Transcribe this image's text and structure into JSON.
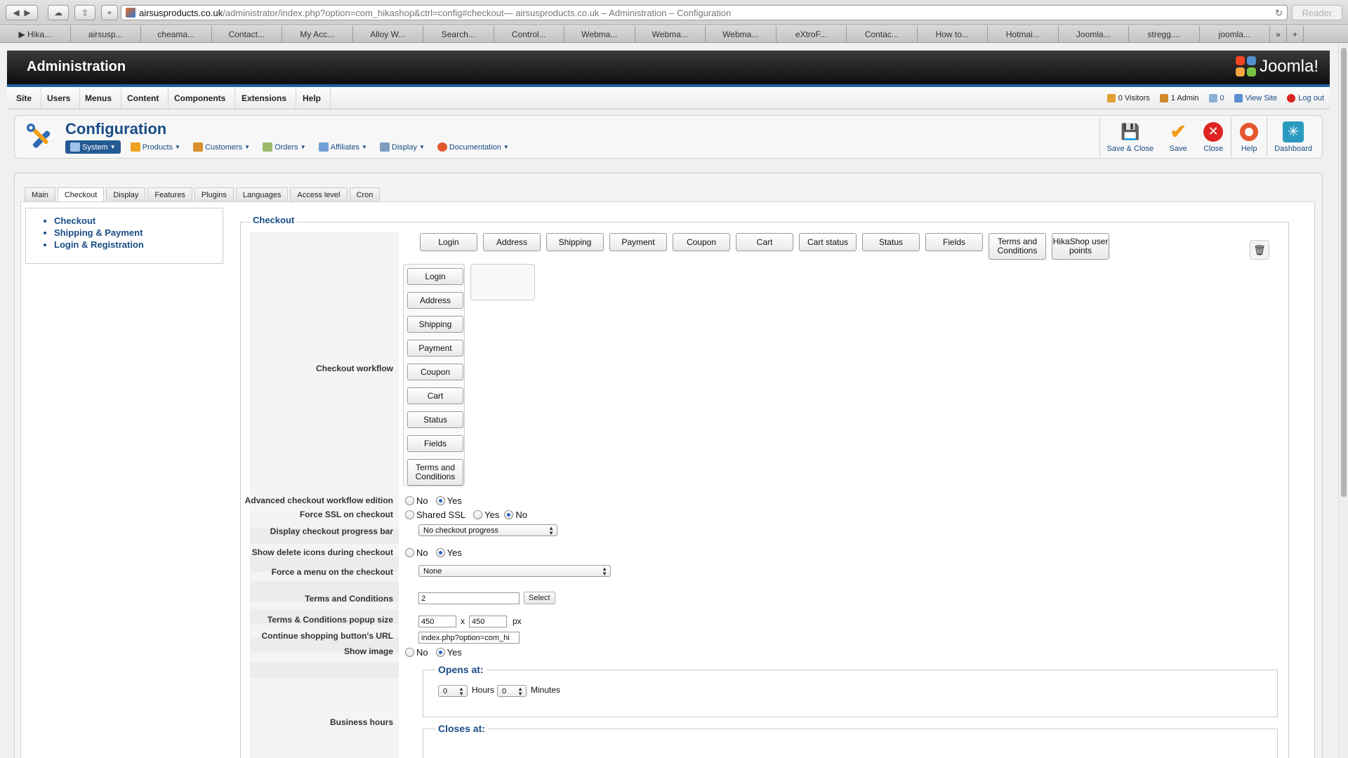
{
  "browser": {
    "url_host": "airsusproducts.co.uk",
    "url_path": "/administrator/index.php?option=com_hikashop&ctrl=config#checkout",
    "url_title": " — airsusproducts.co.uk – Administration – Configuration",
    "reader_label": "Reader",
    "bookmarks": [
      "▶ Hika...",
      "airsusp...",
      "cheama...",
      "Contact...",
      "My Acc...",
      "Alloy W...",
      "Search...",
      "Control...",
      "Webma...",
      "Webma...",
      "Webma...",
      "eXtroF...",
      "Contac...",
      "How to...",
      "Hotmai...",
      "Joomla...",
      "stregg....",
      "joomla..."
    ],
    "bookmarks_more": "»"
  },
  "admin": {
    "title": "Administration",
    "logo_text": "Joomla!"
  },
  "main_menu": [
    "Site",
    "Users",
    "Menus",
    "Content",
    "Components",
    "Extensions",
    "Help"
  ],
  "status": {
    "visitors": "0 Visitors",
    "admins": "1 Admin",
    "messages": "0",
    "view_site": "View Site",
    "logout": "Log out"
  },
  "config_header": {
    "title": "Configuration",
    "submenu": [
      "System",
      "Products",
      "Customers",
      "Orders",
      "Affiliates",
      "Display",
      "Documentation"
    ]
  },
  "toolbar": {
    "save_close": "Save & Close",
    "save": "Save",
    "close": "Close",
    "help": "Help",
    "dashboard": "Dashboard"
  },
  "tabs": [
    "Main",
    "Checkout",
    "Display",
    "Features",
    "Plugins",
    "Languages",
    "Access level",
    "Cron"
  ],
  "side_nav": [
    "Checkout",
    "Shipping & Payment",
    "Login & Registration"
  ],
  "checkout": {
    "legend": "Checkout",
    "available_steps": [
      "Login",
      "Address",
      "Shipping",
      "Payment",
      "Coupon",
      "Cart",
      "Cart status",
      "Status",
      "Fields",
      "Terms and Conditions",
      "HikaShop user points"
    ],
    "workflow_label": "Checkout workflow",
    "workflow_steps": [
      "Login",
      "Address",
      "Shipping",
      "Payment",
      "Coupon",
      "Cart",
      "Status",
      "Fields",
      "Terms and Conditions"
    ],
    "advanced_label": "Advanced checkout workflow edition",
    "no": "No",
    "yes": "Yes",
    "ssl_label": "Force SSL on checkout",
    "shared_ssl": "Shared SSL",
    "progress_label": "Display checkout progress bar",
    "progress_value": "No checkout progress",
    "delete_icons_label": "Show delete icons during checkout",
    "force_menu_label": "Force a menu on the checkout",
    "force_menu_value": "None",
    "terms_label": "Terms and Conditions",
    "terms_value": "2",
    "select_label": "Select",
    "popup_size_label": "Terms & Conditions popup size",
    "popup_w": "450",
    "popup_x": "x",
    "popup_h": "450",
    "popup_unit": "px",
    "continue_url_label": "Continue shopping button's URL",
    "continue_url_value": "index.php?option=com_hi",
    "show_image_label": "Show image",
    "business_hours_label": "Business hours",
    "opens_at": "Opens at:",
    "closes_at": "Closes at:",
    "hours_value": "0",
    "hours_label": "Hours",
    "minutes_value": "0",
    "minutes_label": "Minutes"
  }
}
